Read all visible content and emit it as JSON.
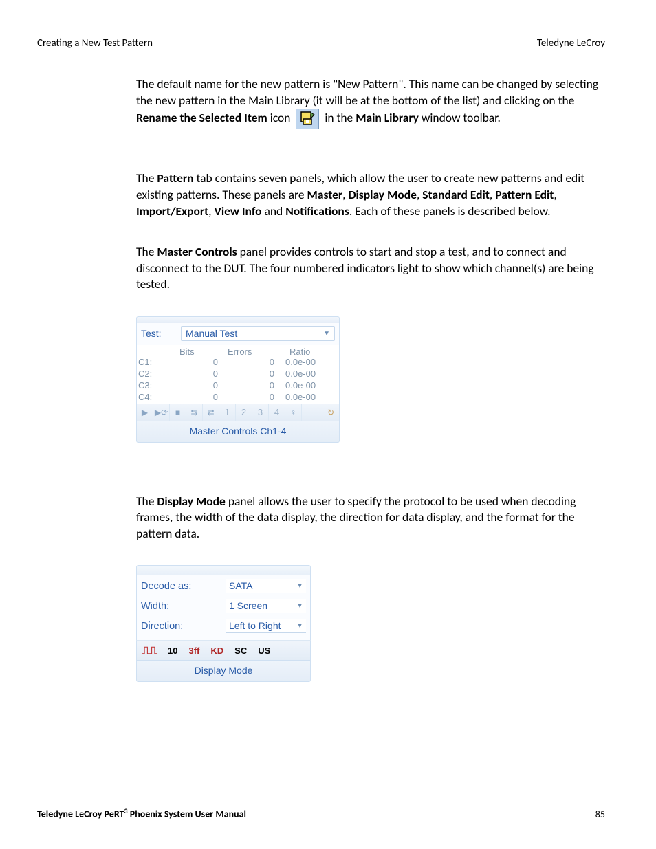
{
  "header": {
    "left": "Creating a New Test Pattern",
    "right": "Teledyne LeCroy"
  },
  "para1": {
    "t1": "The default name for the new pattern is \"New Pattern\". This name can be changed by selecting the new pattern in the Main Library (it will be at the bottom of the list) and clicking on the ",
    "b1": "Rename the Selected Item",
    "t2": " icon ",
    "t3": " in the ",
    "b2": "Main Library",
    "t4": " window toolbar."
  },
  "para2": {
    "t1": "The ",
    "b1": "Pattern",
    "t2": " tab contains seven panels, which allow the user to create new patterns and edit existing patterns. These panels are ",
    "b2": "Master",
    "t3": ", ",
    "b3": "Display Mode",
    "t4": ", ",
    "b4": "Standard Edit",
    "t5": ", ",
    "b5": "Pattern Edit",
    "t6": ", ",
    "b6": "Import/Export",
    "t7": ", ",
    "b7": "View Info",
    "t8": " and ",
    "b8": "Notifications",
    "t9": ". Each of these panels is described below."
  },
  "para3": {
    "t1": "The ",
    "b1": "Master Controls",
    "t2": " panel provides controls to start and stop a test, and to connect and disconnect to the DUT. The four numbered indicators light to show which channel(s) are being tested."
  },
  "master_panel": {
    "test_label": "Test:",
    "test_value": "Manual Test",
    "headers": {
      "bits": "Bits",
      "errors": "Errors",
      "ratio": "Ratio"
    },
    "rows": [
      {
        "ch": "C1:",
        "bits": "0",
        "errors": "0",
        "ratio": "0.0e-00"
      },
      {
        "ch": "C2:",
        "bits": "0",
        "errors": "0",
        "ratio": "0.0e-00"
      },
      {
        "ch": "C3:",
        "bits": "0",
        "errors": "0",
        "ratio": "0.0e-00"
      },
      {
        "ch": "C4:",
        "bits": "0",
        "errors": "0",
        "ratio": "0.0e-00"
      }
    ],
    "toolbar_nums": [
      "1",
      "2",
      "3",
      "4"
    ],
    "caption": "Master Controls Ch1-4"
  },
  "para4": {
    "t1": "The ",
    "b1": "Display Mode",
    "t2": " panel allows the user to specify the protocol to be used when decoding frames, the width of the data display, the direction for data display, and the format for the pattern data."
  },
  "display_panel": {
    "decode_label": "Decode as:",
    "decode_value": "SATA",
    "width_label": "Width:",
    "width_value": "1 Screen",
    "direction_label": "Direction:",
    "direction_value": "Left to Right",
    "toolbar": {
      "i1": "10",
      "i2": "3ff",
      "i3": "KD",
      "i4": "SC",
      "i5": "US"
    },
    "caption": "Display Mode"
  },
  "footer": {
    "product_prefix": "Teledyne LeCroy PeRT",
    "product_sup": "3",
    "product_suffix": " Phoenix System User Manual",
    "page": "85"
  }
}
